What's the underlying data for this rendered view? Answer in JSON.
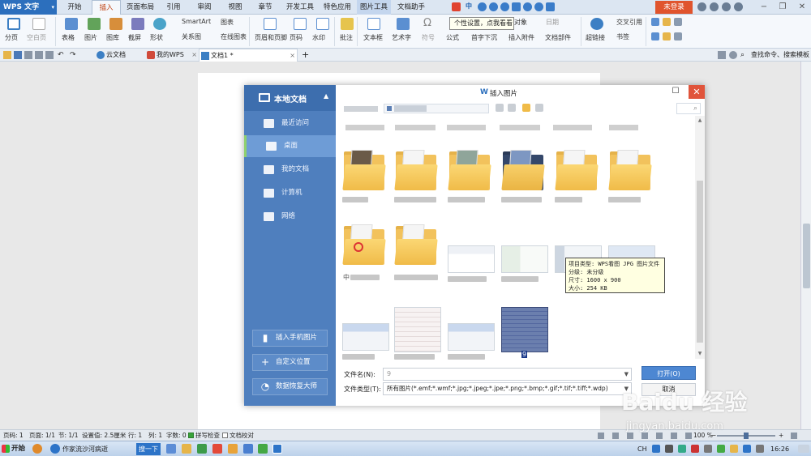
{
  "app": {
    "title": "WPS 文字",
    "login": "未登录"
  },
  "menu": {
    "tabs": [
      "开始",
      "插入",
      "页面布局",
      "引用",
      "审阅",
      "视图",
      "章节",
      "开发工具",
      "特色应用",
      "图片工具",
      "文档助手"
    ],
    "active_tab": "插入"
  },
  "ribbon": {
    "page_break": "分页",
    "blank_page": "空白页",
    "table": "表格",
    "picture": "图片",
    "gallery": "图库",
    "screenshot": "截屏",
    "shape": "形状",
    "smartart": "SmartArt",
    "chart": "图表",
    "relation": "关系图",
    "online_chart": "在线图表",
    "header_footer": "页眉和页脚",
    "page_num": "页码",
    "watermark": "水印",
    "comment": "批注",
    "textbox": "文本框",
    "wordart": "艺术字",
    "symbol": "符号",
    "formula": "公式",
    "dropcap": "首字下沉",
    "attachment": "插入附件",
    "doc_part": "文档部件",
    "hyperlink": "超链接",
    "crossref": "交叉引用",
    "bookmark": "书签",
    "object": "对象",
    "date": "日期"
  },
  "tooltip": "个性设置，点我看看",
  "tabs_bar": {
    "cloud": "云文档",
    "mywps": "我的WPS",
    "doc1": "文档1 *",
    "search": "查找命令、搜索模板"
  },
  "dialog": {
    "title": "插入图片",
    "sidebar": {
      "header": "本地文档",
      "items": [
        {
          "label": "最近访问"
        },
        {
          "label": "桌面"
        },
        {
          "label": "我的文档"
        },
        {
          "label": "计算机"
        },
        {
          "label": "网络"
        }
      ],
      "active": "桌面",
      "buttons": [
        "插入手机图片",
        "自定义位置",
        "数据恢复大师"
      ]
    },
    "tooltip_lines": [
      "项目类型: WPS看图 JPG 图片文件",
      "分级: 未分级",
      "尺寸: 1600 x 900",
      "大小: 254 KB"
    ],
    "partial_label": "中",
    "selected_file": "9",
    "filename_label": "文件名(N):",
    "filename_value": "9",
    "filetype_label": "文件类型(T):",
    "filetype_value": "所有图片(*.emf;*.wmf;*.jpg;*.jpeg;*.jpe;*.png;*.bmp;*.gif;*.tif;*.tiff;*.wdp)",
    "open": "打开(O)",
    "cancel": "取消"
  },
  "status": {
    "page_no": "页码: 1",
    "pages": "页面: 1/1",
    "section": "节: 1/1",
    "setting": "设置值: 2.5厘米",
    "row": "行: 1",
    "col": "列: 1",
    "words": "字数: 0",
    "spell": "拼写检查",
    "doc_check": "文档校对",
    "zoom": "100 %",
    "zoom_level": 0.5
  },
  "taskbar": {
    "start": "开始",
    "item1": "作家流沙河病逝",
    "button": "搜一下",
    "lang": "CH",
    "time": "16:26"
  },
  "watermark": {
    "logo": "Baidu 经验",
    "sub": "jingyan.baidu.com"
  },
  "colors": {
    "accent": "#2c6fbd",
    "dialog_side": "#4f7fbe",
    "close": "#e0543b",
    "open_btn": "#4d87d2"
  }
}
